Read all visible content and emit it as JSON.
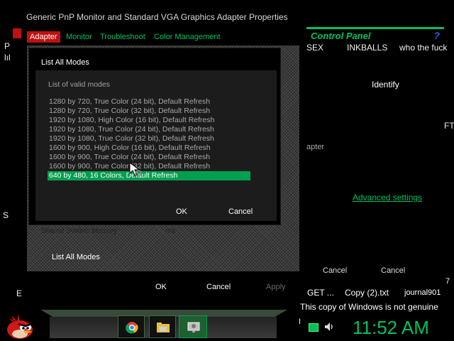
{
  "window": {
    "title": "Generic PnP Monitor and Standard VGA Graphics Adapter Properties",
    "tabs": [
      "Adapter",
      "Monitor",
      "Troubleshoot",
      "Color Management"
    ],
    "shared_memory_label": "Shared System Memory:",
    "shared_memory_value": "n/a",
    "list_all_modes_button": "List All Modes",
    "ok": "OK",
    "cancel": "Cancel",
    "apply": "Apply"
  },
  "dialog": {
    "title": "List All Modes",
    "list_label": "List of valid modes",
    "modes": [
      "1280 by 720, True Color (24 bit), Default Refresh",
      "1280 by 720, True Color (32 bit), Default Refresh",
      "1920 by 1080, High Color (16 bit), Default Refresh",
      "1920 by 1080, True Color (24 bit), Default Refresh",
      "1920 by 1080, True Color (32 bit), Default Refresh",
      "1600 by 900, High Color (16 bit), Default Refresh",
      "1600 by 900, True Color (24 bit), Default Refresh",
      "1600 by 900, True Color (32 bit), Default Refresh",
      "640 by 480, 16 Colors, Default Refresh"
    ],
    "selected_index": 8,
    "ok": "OK",
    "cancel": "Cancel"
  },
  "background": {
    "control_panel_text": "Control Panel",
    "top_text_1": "SEX",
    "top_text_2": "INKBALLS",
    "top_text_3": "who the fuck",
    "identify": "Identify",
    "adapter_fragment": "apter",
    "advanced_settings": "Advanced settings",
    "left_letters": [
      "S",
      "E"
    ],
    "cancel_ghost": "Cancel",
    "apply_ghost": "Apply",
    "right_digit": "7",
    "ft_fragment": "FT"
  },
  "desktop": {
    "files": [
      "GET ...",
      "Copy (2).txt",
      "journal901"
    ],
    "genuine_notice": "This copy of Windows is not genuine"
  },
  "taskbar": {
    "clock": "11:52 AM",
    "letter": "I"
  },
  "colors": {
    "accent": "#00a050",
    "clock": "#00c060",
    "title_text": "#d8d8d8"
  }
}
